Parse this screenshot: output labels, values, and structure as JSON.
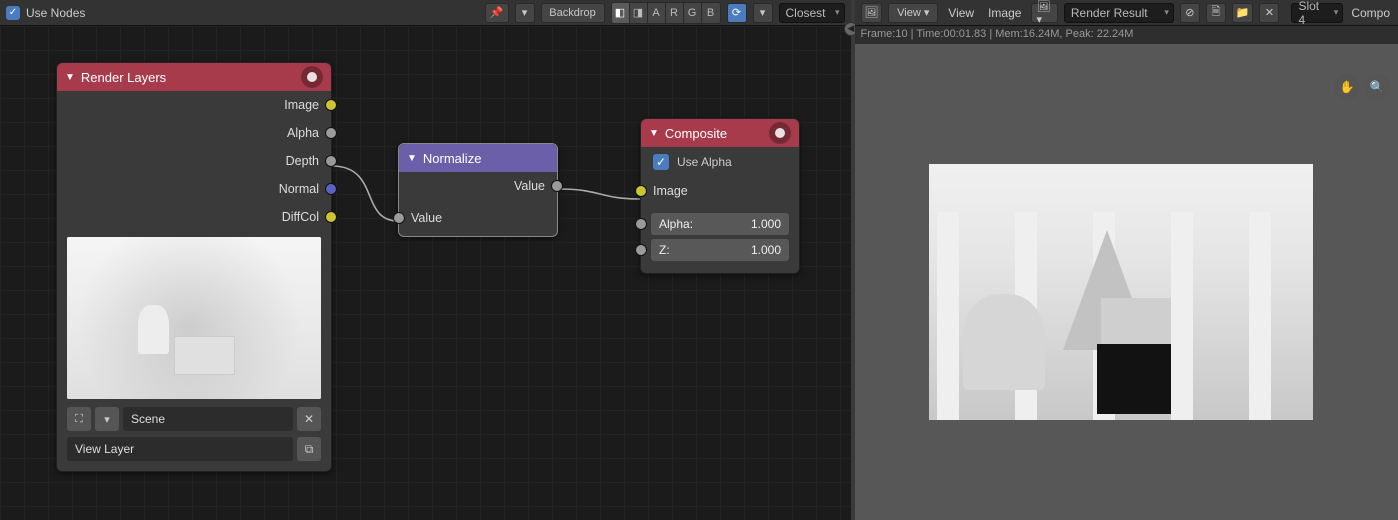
{
  "compositor": {
    "use_nodes_label": "Use Nodes",
    "backdrop_btn": "Backdrop",
    "channel_buttons": [
      "A",
      "R",
      "G",
      "B"
    ],
    "dropdown": "Closest"
  },
  "nodes": {
    "render_layers": {
      "title": "Render Layers",
      "outputs": [
        "Image",
        "Alpha",
        "Depth",
        "Normal",
        "DiffCol"
      ],
      "scene_field": "Scene",
      "viewlayer_field": "View Layer"
    },
    "normalize": {
      "title": "Normalize",
      "output": "Value",
      "input": "Value"
    },
    "composite": {
      "title": "Composite",
      "use_alpha": "Use Alpha",
      "input_image": "Image",
      "alpha_label": "Alpha:",
      "alpha_value": "1.000",
      "z_label": "Z:",
      "z_value": "1.000"
    }
  },
  "image_panel": {
    "view_menu_a": "View",
    "view_menu_b": "View",
    "image_menu": "Image",
    "render_result": "Render Result",
    "slot": "Slot 4",
    "compo": "Compo",
    "status": "Frame:10 | Time:00:01.83 | Mem:16.24M, Peak: 22.24M"
  }
}
